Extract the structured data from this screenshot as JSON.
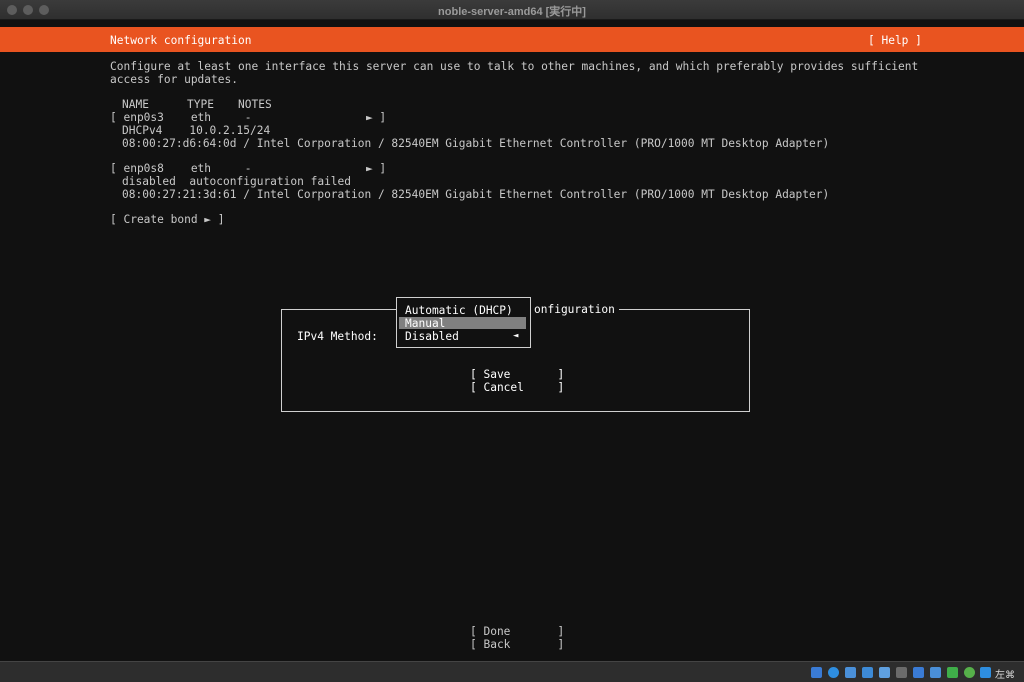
{
  "window": {
    "title": "noble-server-amd64 [実行中]"
  },
  "header": {
    "title": "Network configuration",
    "help": "[ Help ]"
  },
  "intro": {
    "line1": "Configure at least one interface this server can use to talk to other machines, and which preferably provides sufficient",
    "line2": "access for updates."
  },
  "table": {
    "headers": [
      "NAME",
      "TYPE",
      "NOTES"
    ],
    "interfaces": [
      {
        "row": "[ enp0s3    eth     -                 ► ]",
        "status": "DHCPv4    10.0.2.15/24",
        "hw": "08:00:27:d6:64:0d / Intel Corporation / 82540EM Gigabit Ethernet Controller (PRO/1000 MT Desktop Adapter)"
      },
      {
        "row": "[ enp0s8    eth     -                 ► ]",
        "status": "disabled  autoconfiguration failed",
        "hw": "08:00:27:21:3d:61 / Intel Corporation / 82540EM Gigabit Ethernet Controller (PRO/1000 MT Desktop Adapter)"
      }
    ],
    "create_bond": "[ Create bond ► ]"
  },
  "dialog": {
    "title_suffix": "onfiguration",
    "ipv4_label": "IPv4 Method:",
    "save": "[ Save       ]",
    "cancel": "[ Cancel     ]"
  },
  "dropdown": {
    "options": [
      "Automatic (DHCP)",
      "Manual",
      "Disabled"
    ],
    "selected": "Manual",
    "arrow": "◄"
  },
  "footer": {
    "done": "[ Done       ]",
    "back": "[ Back       ]"
  },
  "taskbar": {
    "hostkey": "左⌘"
  },
  "colors": {
    "accent": "#e95420",
    "background": "#111111",
    "selection": "#808080"
  }
}
